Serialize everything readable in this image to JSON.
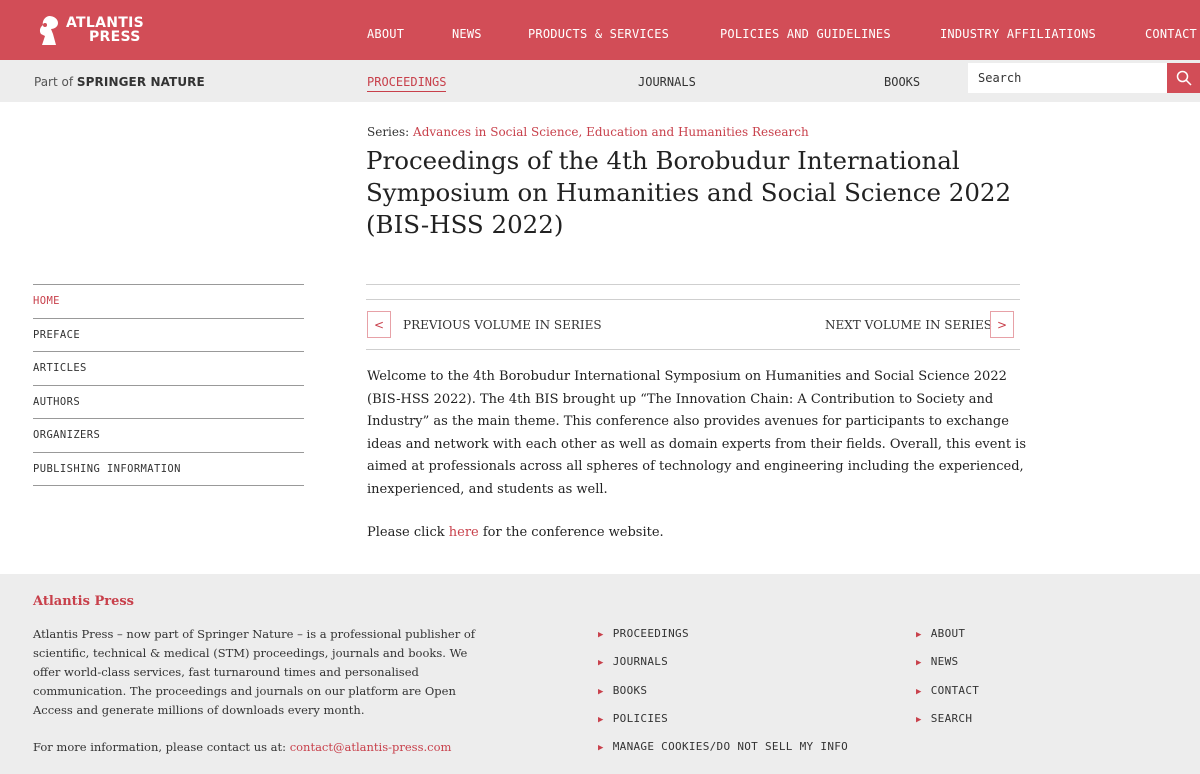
{
  "brand": {
    "logo_line1": "ATLANTIS",
    "logo_line2": "PRESS",
    "part_of_prefix": "Part of",
    "part_of_brand": "SPRINGER NATURE",
    "accent_color": "#d24d57"
  },
  "top_nav": [
    "ABOUT",
    "NEWS",
    "PRODUCTS & SERVICES",
    "POLICIES AND GUIDELINES",
    "INDUSTRY AFFILIATIONS",
    "CONTACT"
  ],
  "sub_nav": {
    "items": [
      "PROCEEDINGS",
      "JOURNALS",
      "BOOKS"
    ],
    "active": "PROCEEDINGS"
  },
  "search": {
    "placeholder": "Search",
    "icon": "search-icon"
  },
  "main": {
    "series_label": "Series:",
    "series_link": "Advances in Social Science, Education and Humanities Research",
    "title": "Proceedings of the 4th Borobudur International Symposium on Humanities and Social Science 2022 (BIS-HSS 2022)",
    "prev_symbol": "<",
    "prev_label": "PREVIOUS VOLUME IN SERIES",
    "next_label": "NEXT VOLUME IN SERIES",
    "next_symbol": ">",
    "intro": "Welcome to the 4th Borobudur International Symposium on Humanities and Social Science 2022 (BIS-HSS 2022). The 4th BIS brought up “The Innovation Chain: A Contribution to Society and Industry” as the main theme. This conference also provides avenues for participants to exchange ideas and network with each other as well as domain experts from their fields. Overall, this event is aimed at professionals across all spheres of technology and engineering including the experienced, inexperienced, and students as well.",
    "click_prefix": "Please click",
    "click_link": "here",
    "click_suffix": "for the conference website."
  },
  "sidebar": {
    "items": [
      "HOME",
      "PREFACE",
      "ARTICLES",
      "AUTHORS",
      "ORGANIZERS",
      "PUBLISHING INFORMATION"
    ],
    "active": "HOME"
  },
  "footer": {
    "title": "Atlantis Press",
    "description": "Atlantis Press – now part of Springer Nature – is a professional publisher of scientific, technical & medical (STM) proceedings, journals and books. We offer world-class services, fast turnaround times and personalised communication. The proceedings and journals on our platform are Open Access and generate millions of downloads every month.",
    "contact_prefix": "For more information, please contact us at:",
    "contact_email": "contact@atlantis-press.com",
    "links_col1": [
      "PROCEEDINGS",
      "JOURNALS",
      "BOOKS",
      "POLICIES",
      "MANAGE COOKIES/DO NOT SELL MY INFO"
    ],
    "links_col2": [
      "ABOUT",
      "NEWS",
      "CONTACT",
      "SEARCH"
    ]
  }
}
